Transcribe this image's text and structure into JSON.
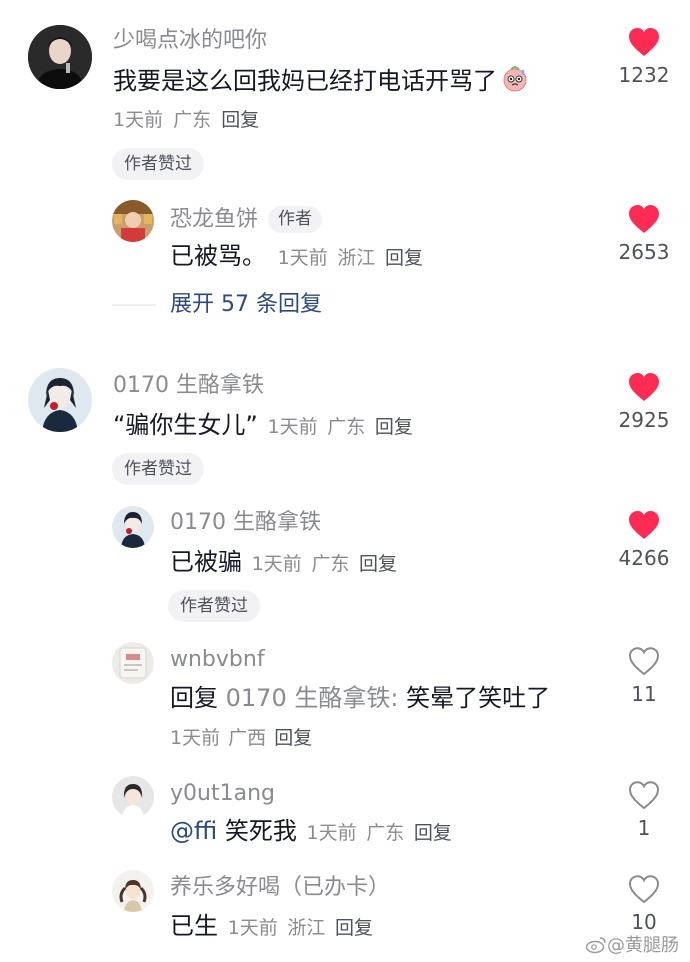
{
  "comments": [
    {
      "username": "少喝点冰的吧你",
      "text": "我要是这么回我妈已经打电话开骂了",
      "time": "1天前",
      "location": "广东",
      "reply_label": "回复",
      "likes": "1232",
      "liked": true,
      "author_liked_badge": "作者赞过",
      "replies": [
        {
          "username": "恐龙鱼饼",
          "author_tag": "作者",
          "text": "已被骂。",
          "time": "1天前",
          "location": "浙江",
          "reply_label": "回复",
          "likes": "2653",
          "liked": true
        }
      ],
      "expand_label": "展开 57 条回复"
    },
    {
      "username": "0170 生酪拿铁",
      "text": "“骗你生女儿”",
      "time": "1天前",
      "location": "广东",
      "reply_label": "回复",
      "likes": "2925",
      "liked": true,
      "author_liked_badge": "作者赞过",
      "replies": [
        {
          "username": "0170 生酪拿铁",
          "text": "已被骗",
          "time": "1天前",
          "location": "广东",
          "reply_label": "回复",
          "likes": "4266",
          "liked": true,
          "author_liked_badge": "作者赞过"
        },
        {
          "username": "wnbvbnf",
          "reply_prefix": "回复",
          "reply_target": "0170 生酪拿铁:",
          "text": "笑晕了笑吐了",
          "time": "1天前",
          "location": "广西",
          "reply_label": "回复",
          "likes": "11",
          "liked": false
        },
        {
          "username": "y0ut1ang",
          "mention": "@ffi",
          "text": "笑死我",
          "time": "1天前",
          "location": "广东",
          "reply_label": "回复",
          "likes": "1",
          "liked": false
        },
        {
          "username": "养乐多好喝（已办卡）",
          "text": "已生",
          "time": "1天前",
          "location": "浙江",
          "reply_label": "回复",
          "likes": "10",
          "liked": false
        }
      ]
    }
  ],
  "watermark": "@黄腿肠",
  "colors": {
    "like_red": "#fe2c55",
    "link_blue": "#2d4a7d",
    "meta_gray": "#8a8b91"
  }
}
